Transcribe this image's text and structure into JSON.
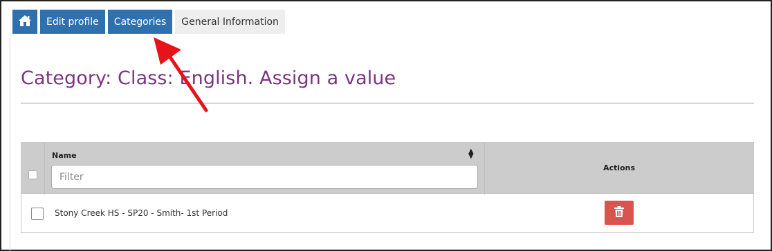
{
  "tabs": {
    "home_icon": "home-icon",
    "edit_profile": "Edit profile",
    "categories": "Categories",
    "general_information": "General Information"
  },
  "page": {
    "title": "Category: Class: English. Assign a value"
  },
  "table": {
    "columns": {
      "name": "Name",
      "actions": "Actions"
    },
    "filter": {
      "placeholder": "Filter",
      "value": ""
    },
    "rows": [
      {
        "name": "Stony Creek HS - SP20 - Smith- 1st Period",
        "checked": false,
        "action_icon": "trash-icon"
      }
    ]
  },
  "colors": {
    "tab_active": "#2f70ae",
    "tab_inactive": "#eeeeee",
    "title": "#7a357f",
    "delete_button": "#d9534f",
    "annotation_arrow": "#e8121b",
    "table_header": "#cccccc"
  }
}
